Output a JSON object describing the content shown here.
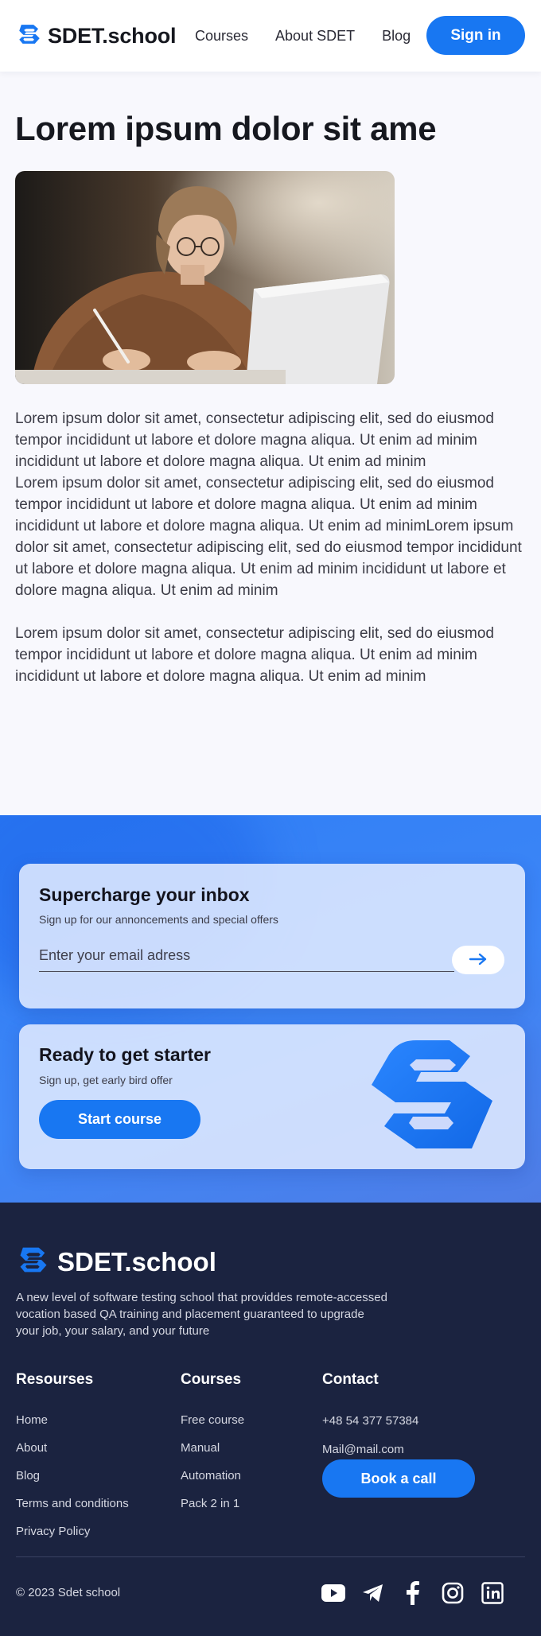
{
  "header": {
    "brand": "SDET.school",
    "nav": [
      "Courses",
      "About SDET",
      "Blog"
    ],
    "signin_label": "Sign in"
  },
  "article": {
    "title": "Lorem ipsum dolor sit ame",
    "paragraph1": "Lorem ipsum dolor sit amet, consectetur adipiscing elit, sed do eiusmod tempor incididunt ut labore et dolore magna aliqua. Ut enim ad minim incididunt ut labore et dolore magna aliqua. Ut enim ad minim\nLorem ipsum dolor sit amet, consectetur adipiscing elit, sed do eiusmod tempor incididunt ut labore et dolore magna aliqua. Ut enim ad minim incididunt ut labore et dolore magna aliqua. Ut enim ad minimLorem ipsum dolor sit amet, consectetur adipiscing elit, sed do eiusmod tempor incididunt ut labore et dolore magna aliqua. Ut enim ad minim incididunt ut labore et dolore magna aliqua. Ut enim ad minim",
    "paragraph2": "Lorem ipsum dolor sit amet, consectetur adipiscing elit, sed do eiusmod tempor incididunt ut labore et dolore magna aliqua. Ut enim ad minim incididunt ut labore et dolore magna aliqua. Ut enim ad minim"
  },
  "newsletter": {
    "title": "Supercharge your inbox",
    "subtitle": "Sign up for our annoncements and special offers",
    "email_placeholder": "Enter your email adress",
    "submit_icon": "arrow-right-icon"
  },
  "starter": {
    "title": "Ready to get starter",
    "subtitle": "Sign up, get early bird offer",
    "button_label": "Start course"
  },
  "footer": {
    "brand": "SDET.school",
    "description": "A new level of software testing school that providdes remote-accessed vocation based QA training and placement guaranteed to upgrade your job, your salary, and your future",
    "resources": {
      "title": "Resourses",
      "links": [
        "Home",
        "About",
        "Blog",
        "Terms and conditions",
        "Privacy Policy"
      ]
    },
    "courses": {
      "title": "Courses",
      "links": [
        "Free course",
        "Manual",
        "Automation",
        "Pack 2 in 1"
      ]
    },
    "contact": {
      "title": "Contact",
      "phone": "+48 54 377 57384",
      "email": "Mail@mail.com",
      "book_label": "Book a call"
    },
    "copyright": "© 2023 Sdet school",
    "socials": [
      "youtube-icon",
      "telegram-icon",
      "facebook-icon",
      "instagram-icon",
      "linkedin-icon"
    ]
  },
  "colors": {
    "accent": "#1877f2",
    "footer_bg": "#1b2340",
    "cta_bg": "#3d86f7"
  }
}
